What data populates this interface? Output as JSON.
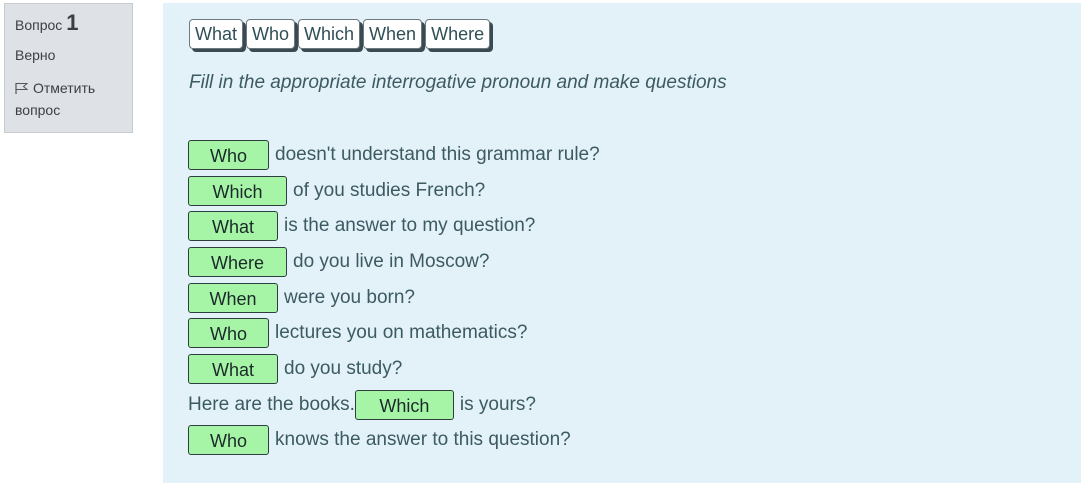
{
  "info": {
    "question_label": "Вопрос",
    "question_number": "1",
    "state": "Верно",
    "flag_label": "Отметить вопрос"
  },
  "choices": [
    "What",
    "Who",
    "Which",
    "When",
    "Where"
  ],
  "instruction": "Fill in the appropriate interrogative pronoun and make questions",
  "rows": [
    {
      "before": "",
      "answer": "Who",
      "after": "doesn't understand this grammar rule?"
    },
    {
      "before": "",
      "answer": "Which",
      "after": "of you studies French?"
    },
    {
      "before": "",
      "answer": "What",
      "after": "is the answer to my question?"
    },
    {
      "before": "",
      "answer": "Where",
      "after": "do you live in Moscow?"
    },
    {
      "before": "",
      "answer": "When",
      "after": "were you born?"
    },
    {
      "before": "",
      "answer": "Who",
      "after": "lectures you on mathematics?"
    },
    {
      "before": "",
      "answer": "What",
      "after": "do you study?"
    },
    {
      "before": "Here are the books.",
      "answer": "Which",
      "after": "is yours?"
    },
    {
      "before": "",
      "answer": "Who",
      "after": "knows the answer to this question?"
    }
  ],
  "colors": {
    "correct_drop": "#a6f5a6",
    "content_bg": "#e2f2f8",
    "info_bg": "#dee2e6"
  }
}
